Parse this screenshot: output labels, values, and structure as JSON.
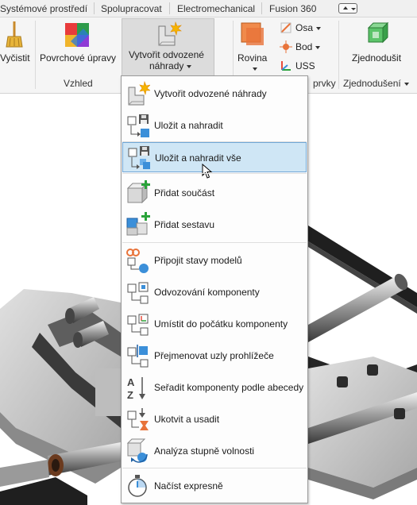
{
  "tabs": [
    "Systémové prostředí",
    "Spolupracovat",
    "Electromechanical",
    "Fusion 360"
  ],
  "ribbon": {
    "vycistit": "Vyčistit",
    "povrchove": "Povrchové úpravy",
    "vytvorit_line1": "Vytvořit odvozené",
    "vytvorit_line2": "náhrady",
    "rovina": "Rovina",
    "osa": "Osa",
    "bod": "Bod",
    "uss": "USS",
    "zjednodusit": "Zjednodušit",
    "group_vzhled": "Vzhled",
    "group_prvky": "prvky",
    "group_zjednoduseni": "Zjednodušení"
  },
  "menu": {
    "items": [
      "Vytvořit odvozené náhrady",
      "Uložit a nahradit",
      "Uložit a nahradit vše",
      "Přidat součást",
      "Přidat sestavu",
      "Připojit stavy modelů",
      "Odvozování komponenty",
      "Umístit do počátku komponenty",
      "Přejmenovat uzly prohlížeče",
      "Seřadit komponenty podle abecedy",
      "Ukotvit a usadit",
      "Analýza stupně volnosti",
      "Načíst expresně"
    ],
    "highlighted_index": 2
  },
  "colors": {
    "highlight_bg": "#cfe6f5",
    "highlight_border": "#6fa6d6",
    "accent_orange": "#e8733a",
    "accent_blue": "#3b8fd9",
    "accent_green": "#2aa33a"
  }
}
